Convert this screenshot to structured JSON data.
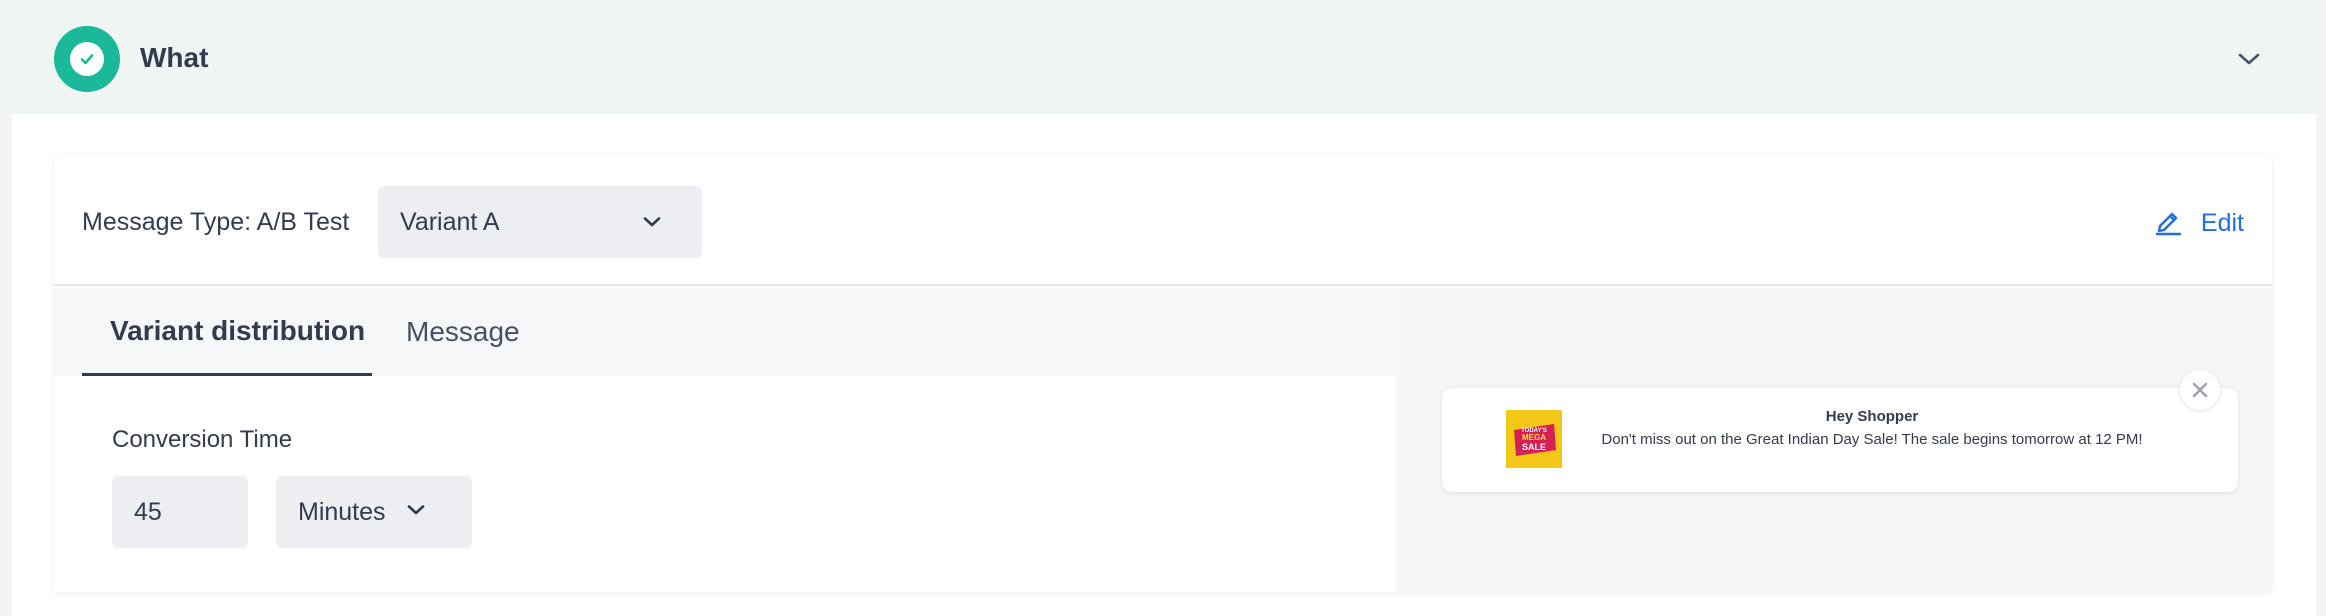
{
  "section": {
    "title": "What",
    "status_icon": "check-circle-icon",
    "accent_color": "#19b99a",
    "collapse_icon": "chevron-down-icon"
  },
  "message_type": {
    "label": "Message Type:",
    "value": "A/B Test",
    "variant_selected": "Variant A",
    "edit_label": "Edit",
    "edit_icon": "pencil-icon",
    "link_color": "#1f6fe0"
  },
  "tabs": [
    {
      "label": "Variant distribution",
      "active": true
    },
    {
      "label": "Message",
      "active": false
    }
  ],
  "conversion": {
    "label": "Conversion Time",
    "value": "45",
    "unit": "Minutes"
  },
  "preview": {
    "title": "Hey Shopper",
    "body": "Don't miss out on the Great Indian Day Sale! The sale begins tomorrow at 12 PM!",
    "image_icon": "mega-sale-banner-icon",
    "image_text": [
      "TODAY'S",
      "MEGA",
      "SALE"
    ],
    "close_icon": "close-icon"
  }
}
